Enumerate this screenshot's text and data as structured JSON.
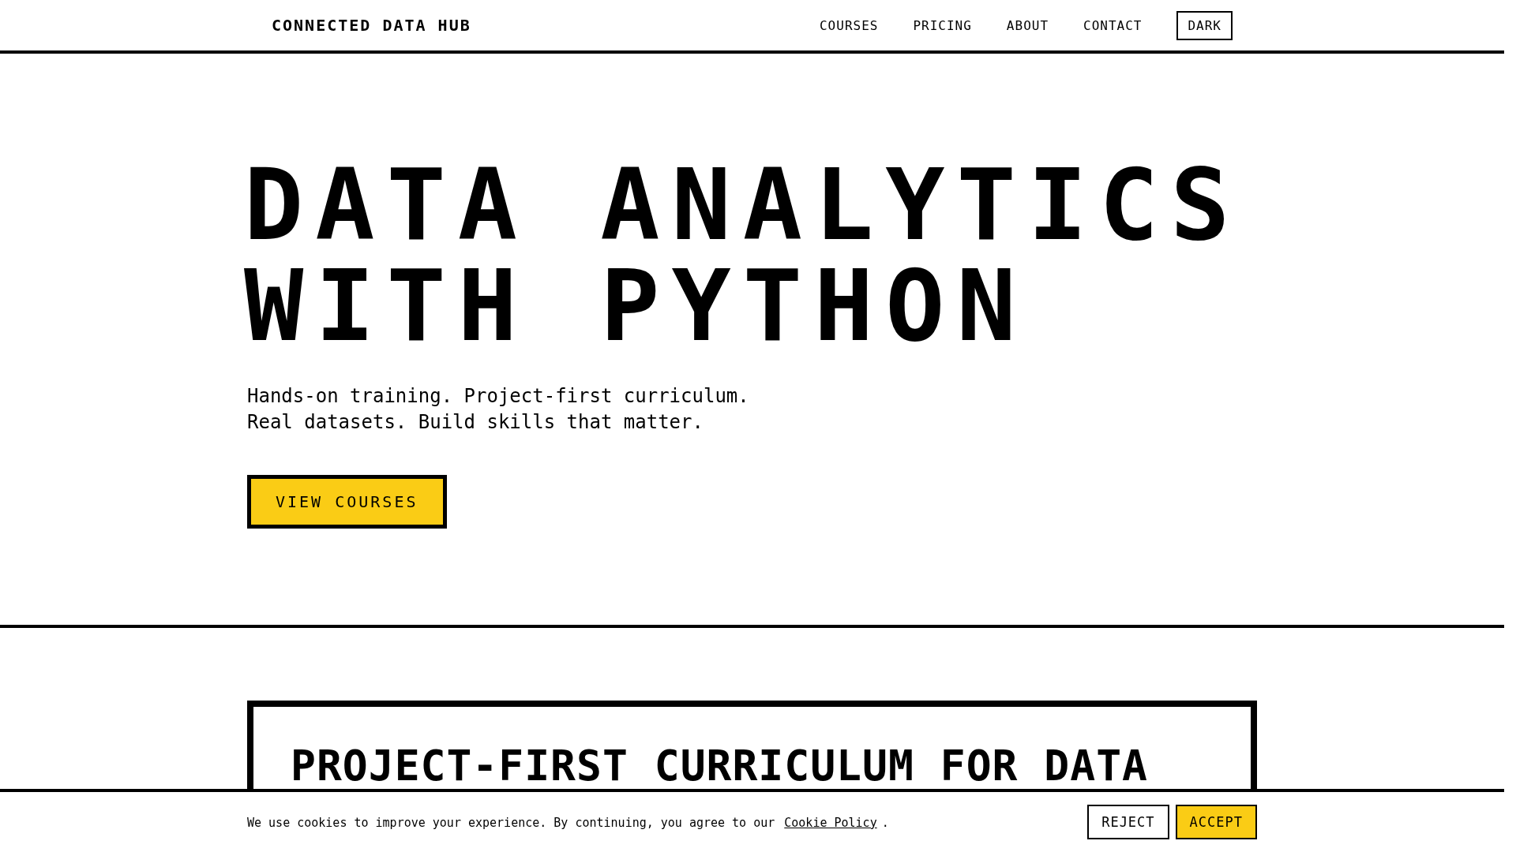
{
  "header": {
    "logo": "CONNECTED DATA HUB",
    "nav": [
      {
        "label": "COURSES"
      },
      {
        "label": "PRICING"
      },
      {
        "label": "ABOUT"
      },
      {
        "label": "CONTACT"
      }
    ],
    "theme_button": "DARK"
  },
  "hero": {
    "title_lines": [
      "DATA ANALYTICS",
      "WITH PYTHON"
    ],
    "subtitle_lines": [
      "Hands-on training. Project-first curriculum.",
      "Real datasets. Build skills that matter."
    ],
    "cta": "VIEW COURSES"
  },
  "card": {
    "title": "PROJECT-FIRST CURRICULUM FOR DATA"
  },
  "cookie_bar": {
    "text": "We use cookies to improve your experience. By continuing, you agree to our",
    "link": "Cookie Policy",
    "after_link": ".",
    "buttons": [
      {
        "kind": "outline",
        "label": "REJECT"
      },
      {
        "kind": "primary",
        "label": "ACCEPT"
      }
    ]
  }
}
